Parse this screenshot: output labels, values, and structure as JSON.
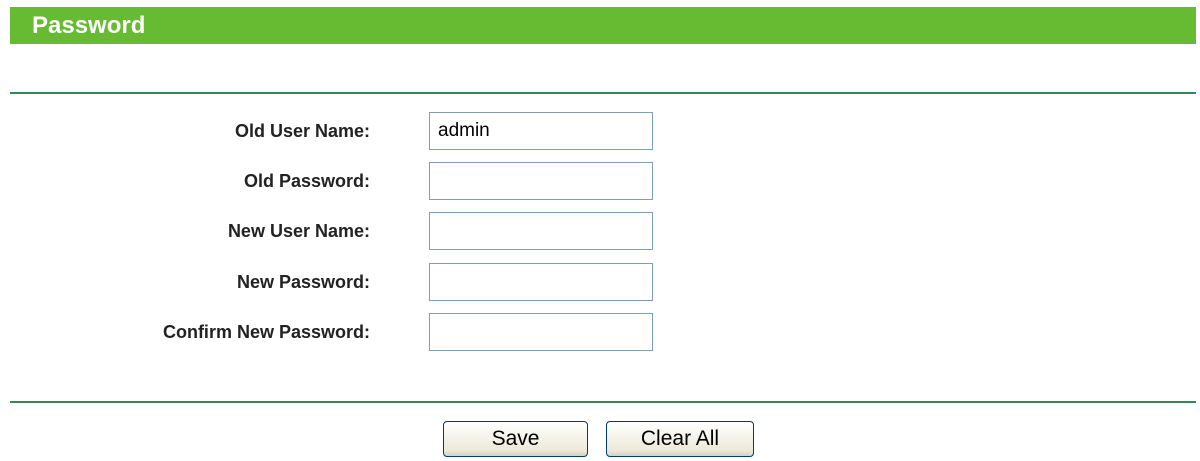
{
  "header": {
    "title": "Password"
  },
  "form": {
    "fields": [
      {
        "label": "Old User Name:",
        "value": "admin",
        "type": "text"
      },
      {
        "label": "Old Password:",
        "value": "",
        "type": "password"
      },
      {
        "label": "New User Name:",
        "value": "",
        "type": "text"
      },
      {
        "label": "New Password:",
        "value": "",
        "type": "password"
      },
      {
        "label": "Confirm New Password:",
        "value": "",
        "type": "password"
      }
    ]
  },
  "buttons": {
    "save_label": "Save",
    "clear_label": "Clear All"
  },
  "colors": {
    "header_bg": "#66bb33",
    "divider": "#2e8b57"
  }
}
